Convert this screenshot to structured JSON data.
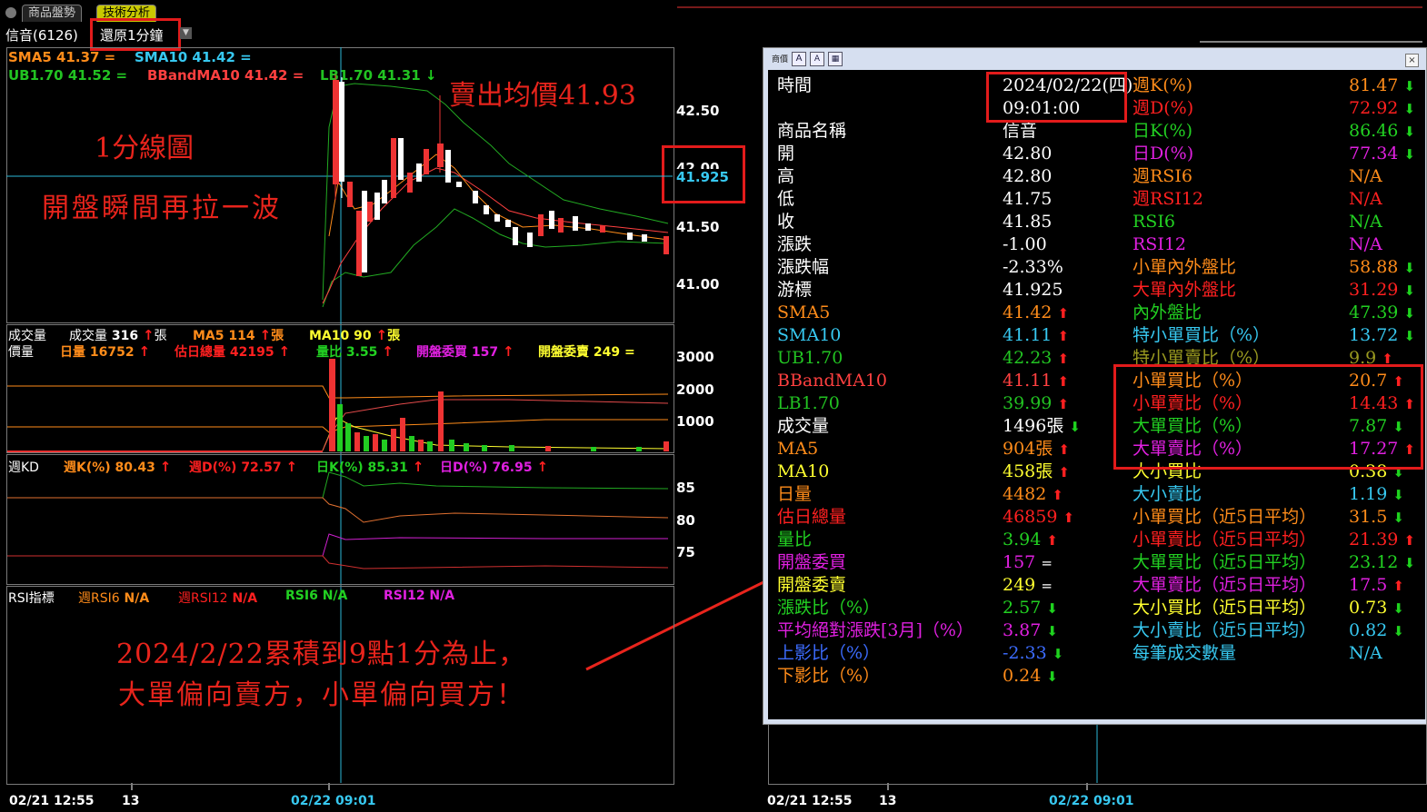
{
  "tabs": [
    {
      "label": "商品盤勢"
    },
    {
      "label": "技術分析"
    }
  ],
  "header": {
    "stock": "信音(6126)",
    "interval": "還原1分鐘"
  },
  "price_panel": {
    "sma5": "SMA5 41.37 =",
    "sma10": "SMA10 41.42 =",
    "ub": "UB1.70 41.52 =",
    "bband": "BBandMA10 41.42 =",
    "lb": "LB1.70 41.31",
    "axis": [
      "42.50",
      "42.00",
      "41.50",
      "41.00"
    ],
    "cursor_price": "41.925"
  },
  "vol_panel": {
    "name": "成交量",
    "label2": "價量",
    "vol": "成交量",
    "vol_val": "316",
    "vol_unit": "張",
    "ma5": "MA5 114",
    "ma5_unit": "張",
    "ma10": "MA10 90",
    "ma10_unit": "張",
    "dayvol": "日量 16752",
    "estvol": "估日總量 42195",
    "ratio": "量比 3.55",
    "openbuy": "開盤委買 157",
    "opensell": "開盤委賣 249 =",
    "axis": [
      "3000",
      "2000",
      "1000"
    ]
  },
  "kd_panel": {
    "name": "週KD",
    "wk": "週K(%) 80.43",
    "wd": "週D(%) 72.57",
    "dk": "日K(%) 85.31",
    "dd": "日D(%) 76.95",
    "axis": [
      "85",
      "80",
      "75"
    ]
  },
  "rsi_panel": {
    "name": "RSI指標",
    "r1": "週RSI6",
    "r1v": "N/A",
    "r2": "週RSI12",
    "r2v": "N/A",
    "r3": "RSI6 N/A",
    "r4": "RSI12 N/A"
  },
  "bottom_axis": {
    "left_date": "02/21 12:55",
    "left_13": "13",
    "mid_date": "02/22 09:01",
    "right_date": "02/21 12:55",
    "right_13": "13",
    "right_mid": "02/22 09:01"
  },
  "annotations": {
    "sell_avg": "賣出均價41.93",
    "chart_type": "1分線圖",
    "open_note": "開盤瞬間再拉一波",
    "summary1": "2024/2/22累積到9點1分為止，",
    "summary2": "大單偏向賣方，小單偏向買方！"
  },
  "popup": {
    "title": "商價",
    "rows_left": [
      {
        "label": "時間",
        "value": "2024/02/22(四)",
        "color": "#ffffff",
        "arrow": ""
      },
      {
        "label": "",
        "value": "09:01:00",
        "color": "#ffffff",
        "arrow": ""
      },
      {
        "label": "商品名稱",
        "value": "信音",
        "color": "#ffffff",
        "arrow": ""
      },
      {
        "label": "開",
        "value": "42.80",
        "color": "#ffffff",
        "arrow": ""
      },
      {
        "label": "高",
        "value": "42.80",
        "color": "#ffffff",
        "arrow": ""
      },
      {
        "label": "低",
        "value": "41.75",
        "color": "#ffffff",
        "arrow": ""
      },
      {
        "label": "收",
        "value": "41.85",
        "color": "#ffffff",
        "arrow": ""
      },
      {
        "label": "漲跌",
        "value": "-1.00",
        "color": "#ffffff",
        "arrow": ""
      },
      {
        "label": "漲跌幅",
        "value": "-2.33%",
        "color": "#ffffff",
        "arrow": ""
      },
      {
        "label": "游標",
        "value": "41.925",
        "color": "#ffffff",
        "arrow": ""
      },
      {
        "label": "SMA5",
        "value": "41.42",
        "color": "#ff8c1a",
        "arrow": "up"
      },
      {
        "label": "SMA10",
        "value": "41.11",
        "color": "#37c8f0",
        "arrow": "up"
      },
      {
        "label": "UB1.70",
        "value": "42.23",
        "color": "#22c322",
        "arrow": "up"
      },
      {
        "label": "BBandMA10",
        "value": "41.11",
        "color": "#ff4040",
        "arrow": "up"
      },
      {
        "label": "LB1.70",
        "value": "39.99",
        "color": "#22c322",
        "arrow": "up"
      },
      {
        "label": "成交量",
        "value": "1496張",
        "color": "#ffffff",
        "arrow": "dn"
      },
      {
        "label": "MA5",
        "value": "904張",
        "color": "#ff8c1a",
        "arrow": "up"
      },
      {
        "label": "MA10",
        "value": "458張",
        "color": "#ffff30",
        "arrow": "up"
      },
      {
        "label": "日量",
        "value": "4482",
        "color": "#ff8c1a",
        "arrow": "up"
      },
      {
        "label": "估日總量",
        "value": "46859",
        "color": "#ff2020",
        "arrow": "up"
      },
      {
        "label": "量比",
        "value": "3.94",
        "color": "#22d022",
        "arrow": "up"
      },
      {
        "label": "開盤委買",
        "value": "157",
        "color": "#e020e0",
        "arrow": "eq"
      },
      {
        "label": "開盤委賣",
        "value": "249",
        "color": "#ffff30",
        "arrow": "eq"
      },
      {
        "label": "漲跌比（%）",
        "value": "2.57",
        "color": "#22d022",
        "arrow": "dn"
      },
      {
        "label": "平均絕對漲跌[3月]（%）",
        "value": "3.87",
        "color": "#e020e0",
        "arrow": "dn"
      },
      {
        "label": "上影比（%）",
        "value": "-2.33",
        "color": "#3c6cff",
        "arrow": "dn"
      },
      {
        "label": "下影比（%）",
        "value": "0.24",
        "color": "#ff8c1a",
        "arrow": "dn"
      }
    ],
    "rows_right": [
      {
        "label": "週K(%)",
        "value": "81.47",
        "color": "#ff8c1a",
        "arrow": "dn"
      },
      {
        "label": "週D(%)",
        "value": "72.92",
        "color": "#ff2020",
        "arrow": "dn"
      },
      {
        "label": "日K(%)",
        "value": "86.46",
        "color": "#22d022",
        "arrow": "dn"
      },
      {
        "label": "日D(%)",
        "value": "77.34",
        "color": "#e020e0",
        "arrow": "dn"
      },
      {
        "label": "週RSI6",
        "value": "N/A",
        "color": "#ff8c1a",
        "arrow": ""
      },
      {
        "label": "週RSI12",
        "value": "N/A",
        "color": "#ff2020",
        "arrow": ""
      },
      {
        "label": "RSI6",
        "value": "N/A",
        "color": "#22d022",
        "arrow": ""
      },
      {
        "label": "RSI12",
        "value": "N/A",
        "color": "#e020e0",
        "arrow": ""
      },
      {
        "label": "小單內外盤比",
        "value": "58.88",
        "color": "#ff8c1a",
        "arrow": "dn"
      },
      {
        "label": "大單內外盤比",
        "value": "31.29",
        "color": "#ff2020",
        "arrow": "dn"
      },
      {
        "label": "內外盤比",
        "value": "47.39",
        "color": "#22d022",
        "arrow": "dn"
      },
      {
        "label": "特小單買比（%）",
        "value": "13.72",
        "color": "#37c8f0",
        "arrow": "dn"
      },
      {
        "label": "特小單賣比（%）",
        "value": "9.9",
        "color": "#9a9a20",
        "arrow": "up"
      },
      {
        "label": "小單買比（%）",
        "value": "20.7",
        "color": "#ff8c1a",
        "arrow": "up"
      },
      {
        "label": "小單賣比（%）",
        "value": "14.43",
        "color": "#ff2020",
        "arrow": "up"
      },
      {
        "label": "大單買比（%）",
        "value": "7.87",
        "color": "#22d022",
        "arrow": "dn"
      },
      {
        "label": "大單賣比（%）",
        "value": "17.27",
        "color": "#e020e0",
        "arrow": "up"
      },
      {
        "label": "大小買比",
        "value": "0.38",
        "color": "#ffff30",
        "arrow": "dn"
      },
      {
        "label": "大小賣比",
        "value": "1.19",
        "color": "#37c8f0",
        "arrow": "dn"
      },
      {
        "label": "小單買比（近5日平均）",
        "value": "31.5",
        "color": "#ff8c1a",
        "arrow": "dn"
      },
      {
        "label": "小單賣比（近5日平均）",
        "value": "21.39",
        "color": "#ff2020",
        "arrow": "up"
      },
      {
        "label": "大單買比（近5日平均）",
        "value": "23.12",
        "color": "#22d022",
        "arrow": "dn"
      },
      {
        "label": "大單賣比（近5日平均）",
        "value": "17.5",
        "color": "#e020e0",
        "arrow": "up"
      },
      {
        "label": "大小買比（近5日平均）",
        "value": "0.73",
        "color": "#ffff30",
        "arrow": "dn"
      },
      {
        "label": "大小賣比（近5日平均）",
        "value": "0.82",
        "color": "#37c8f0",
        "arrow": "dn"
      },
      {
        "label": "每筆成交數量",
        "value": "N/A",
        "color": "#37c8f0",
        "arrow": ""
      }
    ]
  }
}
